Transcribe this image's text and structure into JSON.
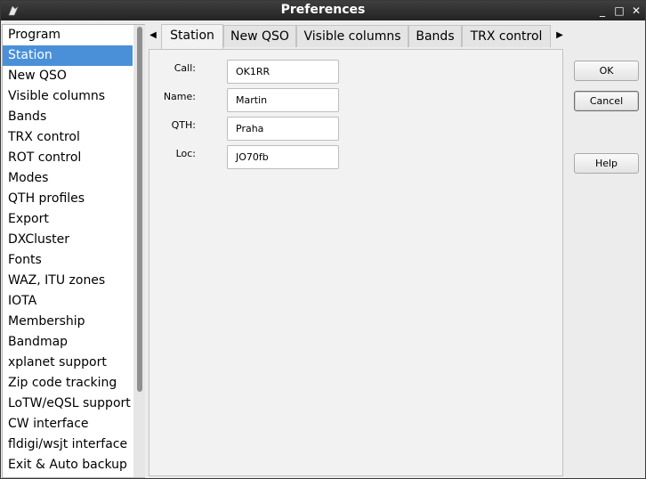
{
  "window": {
    "title": "Preferences",
    "controls": {
      "minimize": "_",
      "maximize": "□",
      "close": "✕"
    }
  },
  "sidebar": {
    "items": [
      {
        "label": "Program"
      },
      {
        "label": "Station"
      },
      {
        "label": "New QSO"
      },
      {
        "label": "Visible columns"
      },
      {
        "label": "Bands"
      },
      {
        "label": "TRX control"
      },
      {
        "label": "ROT control"
      },
      {
        "label": "Modes"
      },
      {
        "label": "QTH profiles"
      },
      {
        "label": "Export"
      },
      {
        "label": "DXCluster"
      },
      {
        "label": "Fonts"
      },
      {
        "label": "WAZ, ITU zones"
      },
      {
        "label": "IOTA"
      },
      {
        "label": "Membership"
      },
      {
        "label": "Bandmap"
      },
      {
        "label": "xplanet support"
      },
      {
        "label": "Zip code tracking"
      },
      {
        "label": "LoTW/eQSL support"
      },
      {
        "label": "CW interface"
      },
      {
        "label": "fldigi/wsjt interface"
      },
      {
        "label": "Exit & Auto backup"
      }
    ],
    "selected": "Station"
  },
  "tabs": {
    "scroll_left": "◀",
    "scroll_right": "▶",
    "items": [
      {
        "label": "Station"
      },
      {
        "label": "New QSO"
      },
      {
        "label": "Visible columns"
      },
      {
        "label": "Bands"
      },
      {
        "label": "TRX control"
      }
    ],
    "active": "Station"
  },
  "station": {
    "call_label": "Call:",
    "call_value": "OK1RR",
    "name_label": "Name:",
    "name_value": "Martin",
    "qth_label": "QTH:",
    "qth_value": "Praha",
    "loc_label": "Loc:",
    "loc_value": "JO70fb"
  },
  "buttons": {
    "ok": "OK",
    "cancel": "Cancel",
    "help": "Help"
  },
  "colors": {
    "selection": "#4a90d9",
    "titlebar": "#2b2b2b"
  }
}
